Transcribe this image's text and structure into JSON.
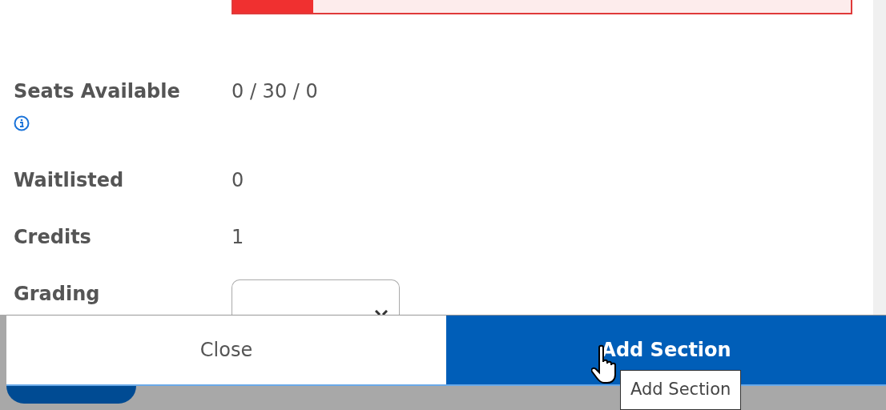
{
  "progress": {
    "level": 0.13
  },
  "fields": [
    {
      "kind": "text",
      "label": "Seats Available",
      "info": true,
      "value": "0 / 30 / 0"
    },
    {
      "kind": "text",
      "label": "Waitlisted",
      "info": false,
      "value": "0"
    },
    {
      "kind": "text",
      "label": "Credits",
      "info": false,
      "value": "1"
    },
    {
      "kind": "select",
      "label": "Grading",
      "info": false
    }
  ],
  "footer": {
    "buttons": [
      {
        "label": "Close",
        "kind": "secondary"
      },
      {
        "label": "Add Section",
        "kind": "primary"
      }
    ]
  },
  "tooltip": "Add Section"
}
